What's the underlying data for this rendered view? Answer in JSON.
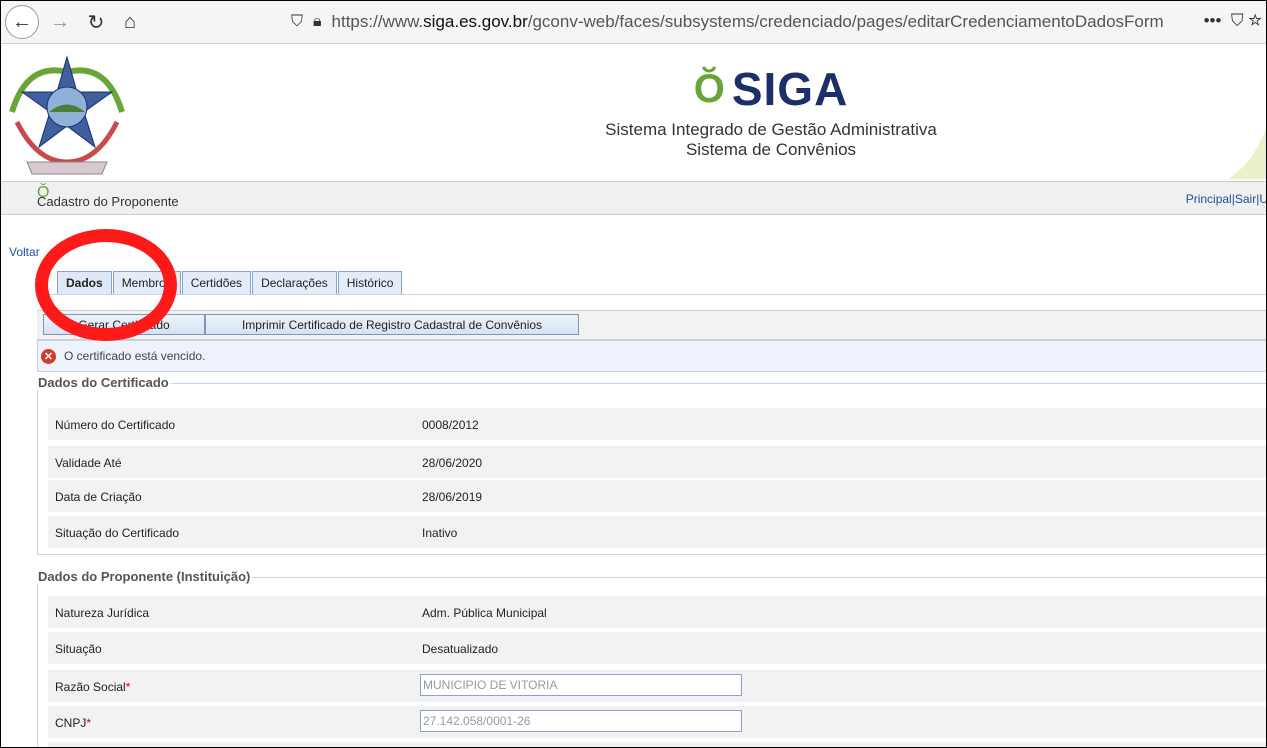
{
  "browser": {
    "url_prefix": "https://www.",
    "url_domain": "siga.es.gov.br",
    "url_path": "/gconv-web/faces/subsystems/credenciado/pages/editarCredenciamentoDadosForm",
    "overflow_icon": "•••"
  },
  "header": {
    "logo_text": "SIGA",
    "subtitle1": "Sistema Integrado de Gestão Administrativa",
    "subtitle2": "Sistema de Convênios"
  },
  "titlebar": {
    "title": "Cadastro do Proponente",
    "link_principal": "Principal",
    "link_sair": "Sair",
    "link_sep": "|",
    "link_u": "U"
  },
  "voltar": "Voltar",
  "tabs": [
    {
      "label": "Dados",
      "active": true
    },
    {
      "label": "Membros"
    },
    {
      "label": "Certidões"
    },
    {
      "label": "Declarações"
    },
    {
      "label": "Histórico"
    }
  ],
  "toolbar": {
    "btn1": "Gerar Certificado",
    "btn2": "Imprimir Certificado de Registro Cadastral de Convênios"
  },
  "message": {
    "text": "O certificado está vencido.",
    "color": "#d63a2a"
  },
  "certificado": {
    "legend": "Dados do Certificado",
    "rows": [
      {
        "label": "Número do Certificado",
        "value": "0008/2012"
      },
      {
        "label": "Validade Até",
        "value": "28/06/2020"
      },
      {
        "label": "Data de Criação",
        "value": "28/06/2019"
      },
      {
        "label": "Situação do Certificado",
        "value": "Inativo"
      }
    ]
  },
  "proponente": {
    "legend": "Dados do Proponente (Instituição)",
    "rows": [
      {
        "label": "Natureza Jurídica",
        "value": "Adm. Pública Municipal"
      },
      {
        "label": "Situação",
        "value": "Desatualizado"
      }
    ],
    "razao_label": "Razão Social",
    "razao_value": "MUNICIPIO DE VITORIA",
    "cnpj_label": "CNPJ",
    "cnpj_value": "27.142.058/0001-26",
    "required_mark": "*"
  },
  "colors": {
    "accent": "#1a4f9c",
    "annotation": "#ff1a1a"
  }
}
